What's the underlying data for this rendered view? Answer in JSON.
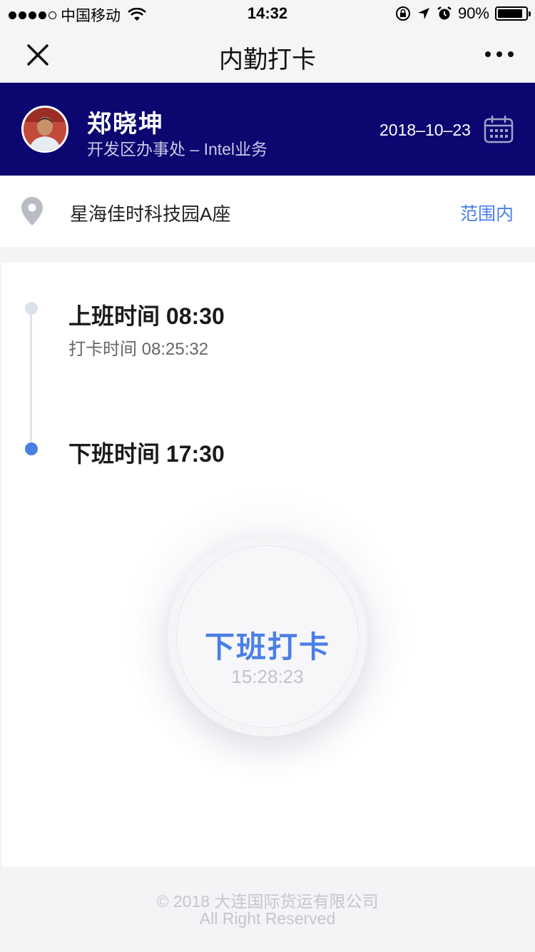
{
  "status_bar": {
    "carrier": "中国移动",
    "time": "14:32",
    "battery": "90%",
    "battery_level": 0.9
  },
  "nav": {
    "title": "内勤打卡"
  },
  "profile": {
    "name": "郑晓坤",
    "department": "开发区办事处 – Intel业务",
    "date": "2018–10–23"
  },
  "location": {
    "place": "星海佳时科技园A座",
    "status": "范围内"
  },
  "timeline": {
    "on_duty": "上班时间 08:30",
    "on_duty_punch": "打卡时间 08:25:32",
    "off_duty": "下班时间 17:30"
  },
  "punch_button": {
    "label": "下班打卡",
    "time": "15:28:23"
  },
  "footer": {
    "copyright": "© 2018 大连国际货运有限公司",
    "rights": "All Right Reserved"
  },
  "colors": {
    "header_bg": "#0b0670",
    "accent": "#4a7fe6"
  }
}
